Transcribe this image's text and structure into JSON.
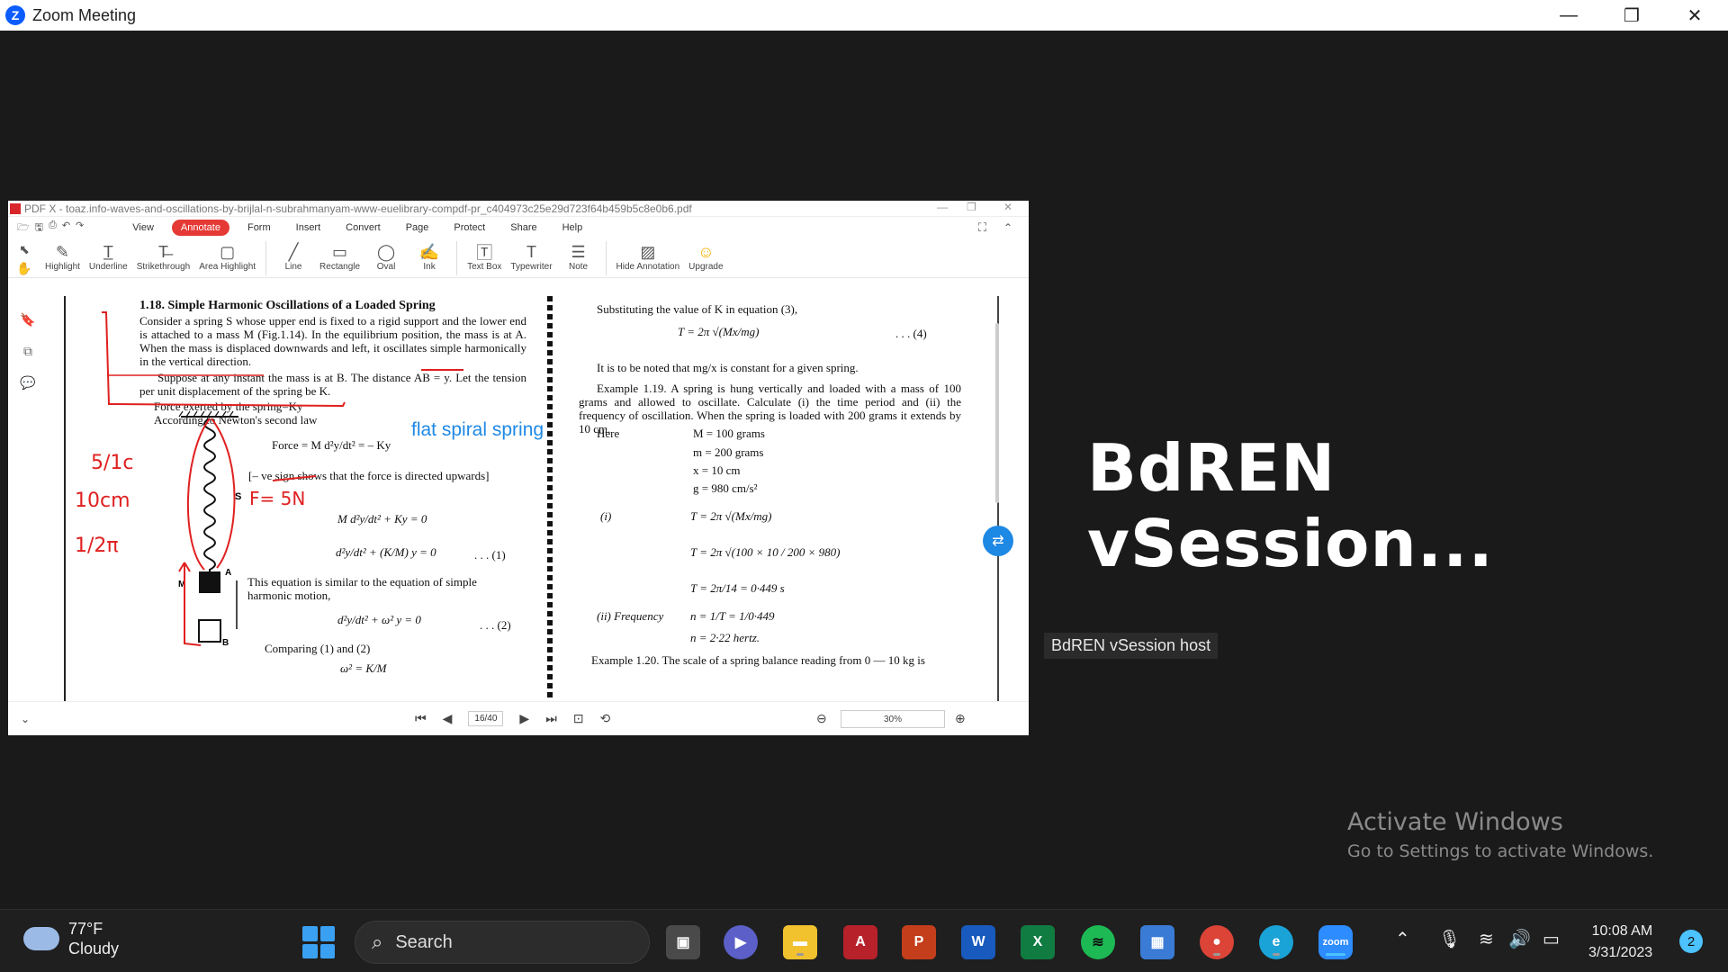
{
  "window": {
    "title": "Zoom Meeting",
    "minimize": "—",
    "restore": "❐",
    "close": "✕"
  },
  "pdf": {
    "title": "PDF X - toaz.info-waves-and-oscillations-by-brijlal-n-subrahmanyam-www-euelibrary-compdf-pr_c404973c25e29d723f64b459b5c8e0b6.pdf",
    "menu": [
      "View",
      "Annotate",
      "Form",
      "Insert",
      "Convert",
      "Page",
      "Protect",
      "Share",
      "Help"
    ],
    "active_menu": "Annotate",
    "tools": [
      "Highlight",
      "Underline",
      "Strikethrough",
      "Area Highlight",
      "Line",
      "Rectangle",
      "Oval",
      "Ink",
      "Text Box",
      "Typewriter",
      "Note",
      "Hide Annotation",
      "Upgrade"
    ],
    "page_indicator": "16/40",
    "zoom": "30%",
    "content": {
      "section_heading": "1.18.   Simple Harmonic Oscillations of a Loaded Spring",
      "para1": "Consider a spring S whose upper end is fixed to a rigid support and the lower end is attached to a mass M (Fig.1.14). In the equilibrium position, the mass is at A. When the mass is displaced downwards and left, it oscillates simple harmonically in the vertical direction.",
      "para2": "Suppose at any instant the mass is at B. The distance AB = y. Let the tension per unit displacement of the spring be K.",
      "force_line": "Force exerted by the spring=Ky",
      "newton_line": "According to Newton's second law",
      "force_eq": "Force = M d²y/dt² = – Ky",
      "sign_note": "[– ve sign shows that the force is directed upwards]",
      "eq_a": "M d²y/dt² + Ky = 0",
      "eq1": "d²y/dt² + (K/M) y = 0",
      "eq1_num": ". . . (1)",
      "similar_text": "This equation is similar to the equation of simple harmonic motion,",
      "eq2": "d²y/dt² + ω² y = 0",
      "eq2_num": ". . . (2)",
      "comparing": "Comparing (1) and (2)",
      "omega_eq": "ω² = K/M",
      "subst": "Substituting the value of K in equation (3),",
      "T_eq": "T = 2π √(Mx/mg)",
      "eq4_num": ". . . (4)",
      "noted": "It is to be noted that mg/x is constant for a given spring.",
      "ex119": "Example 1.19.  A spring is hung vertically and loaded with a mass of 100 grams and allowed to oscillate. Calculate (i) the time period and (ii) the frequency of oscillation. When the spring is loaded with 200 grams it extends by 10 cm.",
      "here": "Here",
      "given": [
        "M = 100 grams",
        "m = 200 grams",
        "x = 10 cm",
        "g = 980 cm/s²"
      ],
      "part_i": "(i)",
      "calc1": "T = 2π √(Mx/mg)",
      "calc2": "T = 2π √(100 × 10 / 200 × 980)",
      "calc3": "T = 2π/14 = 0·449 s",
      "part_ii": "(ii) Frequency",
      "freq1": "n = 1/T = 1/0·449",
      "freq2": "n = 2·22 hertz.",
      "ex120": "Example 1.20. The scale of a spring balance reading from  0 — 10 kg is",
      "annotation_note": "flat spiral spring",
      "label_S": "S",
      "label_M": "M",
      "label_A": "A",
      "label_B": "B",
      "ink_notes": [
        "5/1c",
        "10cm",
        "1/2π",
        "F= 5N"
      ]
    }
  },
  "session": {
    "title": "BdREN  vSession...",
    "host_tag": "BdREN vSession host"
  },
  "watermark": {
    "line1": "Activate Windows",
    "line2": "Go to Settings to activate Windows."
  },
  "taskbar": {
    "weather_temp": "77°F",
    "weather_desc": "Cloudy",
    "search_placeholder": "Search",
    "time": "10:08 AM",
    "date": "3/31/2023",
    "notifications": "2"
  },
  "colors": {
    "accent_red": "#e53935",
    "zoom_blue": "#0b5cff",
    "ink_red": "#e02020",
    "note_blue": "#1e88e5"
  }
}
